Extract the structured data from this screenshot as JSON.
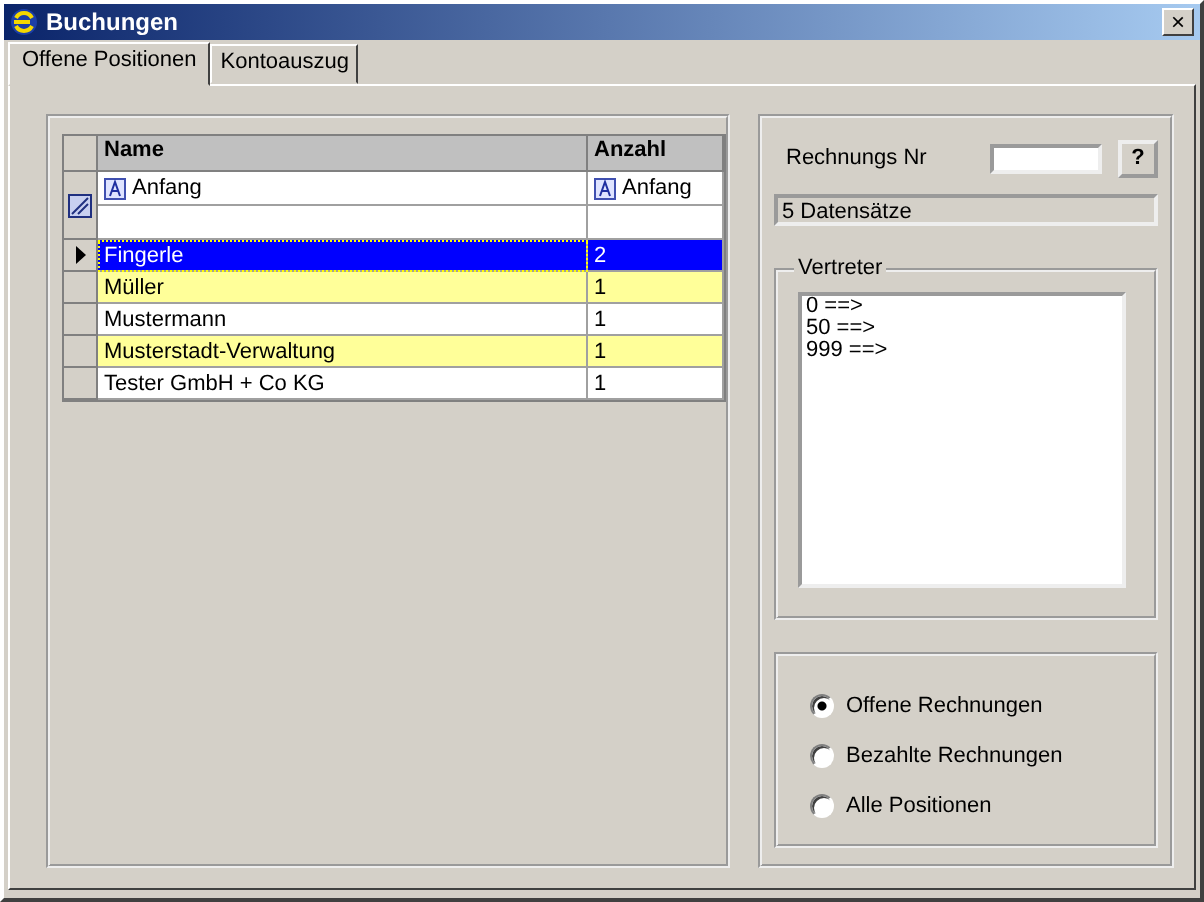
{
  "window": {
    "title": "Buchungen",
    "close": "×"
  },
  "tabs": [
    {
      "label": "Offene Positionen",
      "selected": true
    },
    {
      "label": "Kontoauszug",
      "selected": false
    }
  ],
  "table": {
    "columns": [
      "Name",
      "Anzahl"
    ],
    "filter": [
      "Anfang",
      "Anfang"
    ],
    "rows": [
      {
        "cells": [
          "Fingerle",
          "2"
        ],
        "selected": true,
        "highlighted": false
      },
      {
        "cells": [
          "Müller",
          "1"
        ],
        "selected": false,
        "highlighted": true
      },
      {
        "cells": [
          "Mustermann",
          "1"
        ],
        "selected": false,
        "highlighted": false
      },
      {
        "cells": [
          "Musterstadt-Verwaltung",
          "1"
        ],
        "selected": false,
        "highlighted": true
      },
      {
        "cells": [
          "Tester GmbH + Co KG",
          "1"
        ],
        "selected": false,
        "highlighted": false
      }
    ]
  },
  "invoice_search": {
    "label": "Rechnungs Nr",
    "help_button": "?"
  },
  "record_count": "5 Datensätze",
  "vertreter": {
    "title": "Vertreter",
    "items": [
      "0 ==>",
      "50 ==>",
      "999 ==>"
    ]
  },
  "filter_options": [
    {
      "label": "Offene Rechnungen",
      "selected": true
    },
    {
      "label": "Bezahlte Rechnungen",
      "selected": false
    },
    {
      "label": "Alle Positionen",
      "selected": false
    }
  ]
}
